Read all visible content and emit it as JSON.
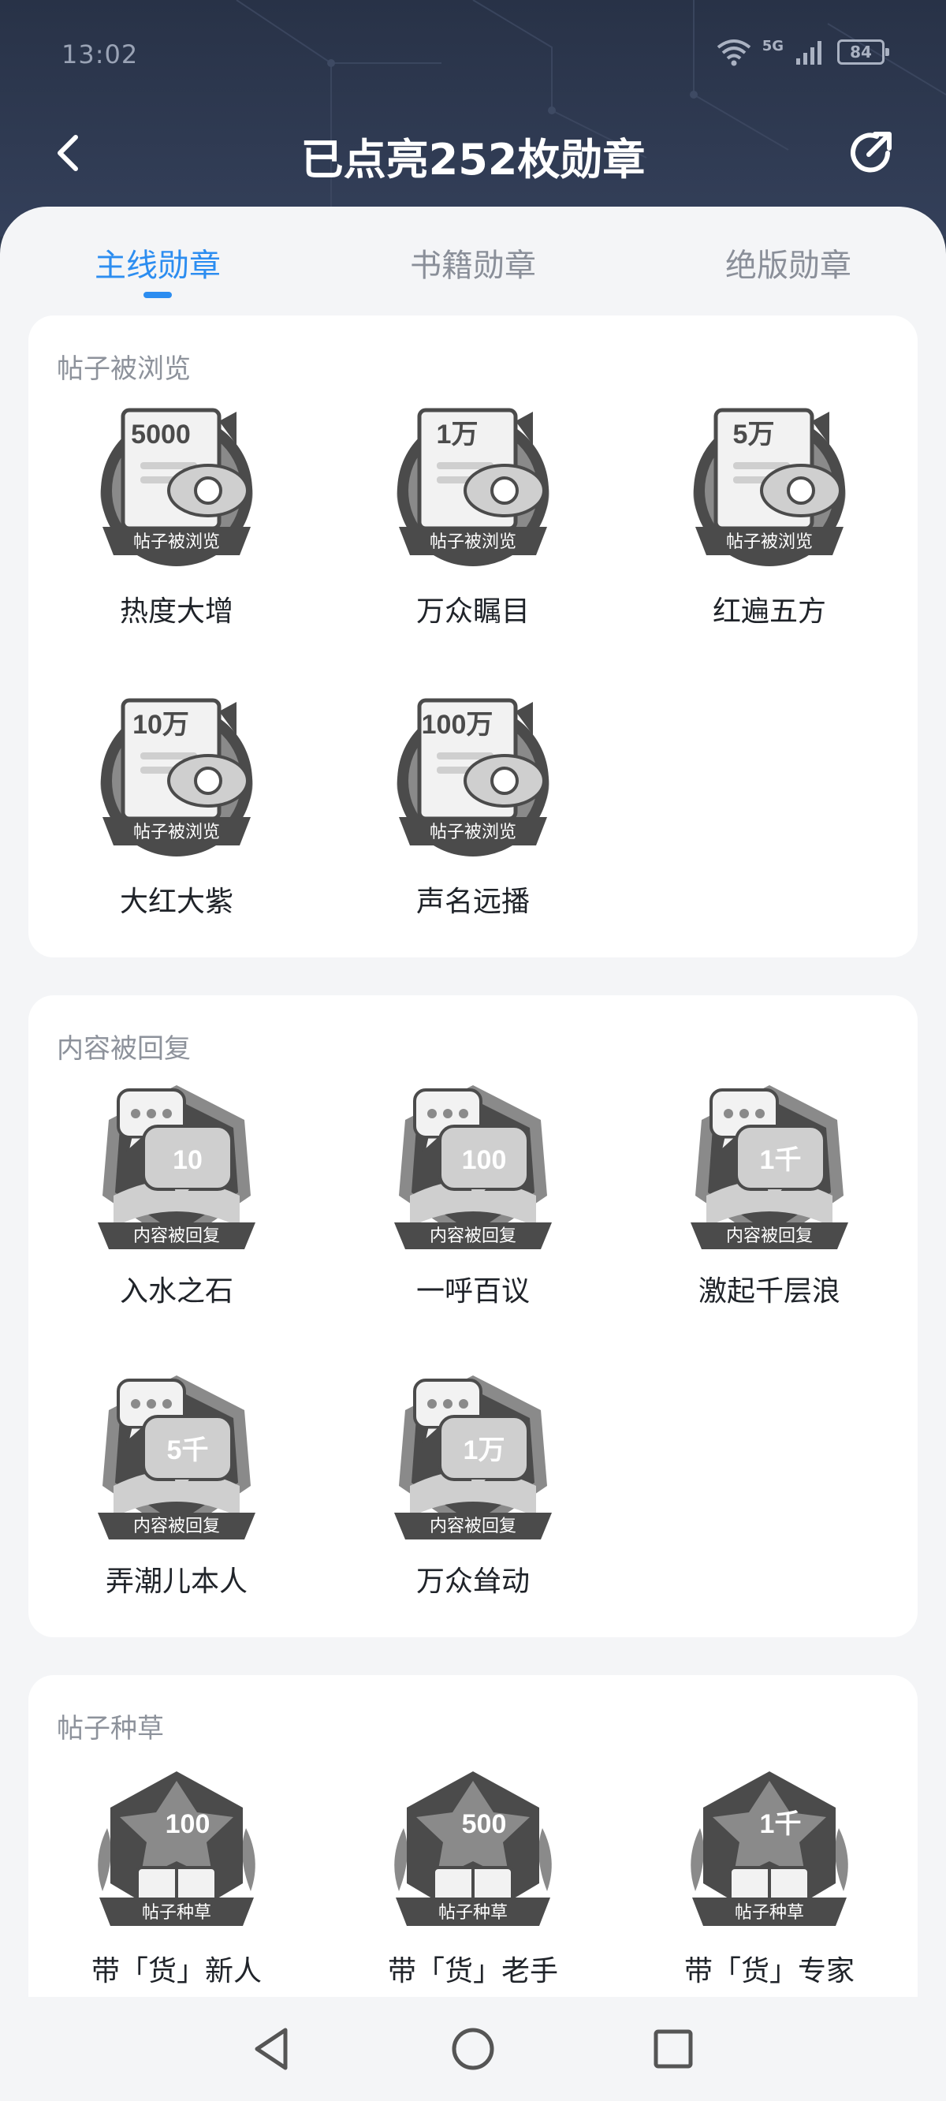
{
  "status": {
    "time": "13:02",
    "network": "5G",
    "battery": "84"
  },
  "nav": {
    "title": "已点亮252枚勋章"
  },
  "tabs": [
    {
      "label": "主线勋章",
      "active": true
    },
    {
      "label": "书籍勋章",
      "active": false
    },
    {
      "label": "绝版勋章",
      "active": false
    }
  ],
  "sections": [
    {
      "title": "帖子被浏览",
      "type": "view",
      "badges": [
        {
          "value": "5000",
          "ribbon": "帖子被浏览",
          "name": "热度大增"
        },
        {
          "value": "1万",
          "ribbon": "帖子被浏览",
          "name": "万众瞩目"
        },
        {
          "value": "5万",
          "ribbon": "帖子被浏览",
          "name": "红遍五方"
        },
        {
          "value": "10万",
          "ribbon": "帖子被浏览",
          "name": "大红大紫"
        },
        {
          "value": "100万",
          "ribbon": "帖子被浏览",
          "name": "声名远播"
        }
      ]
    },
    {
      "title": "内容被回复",
      "type": "reply",
      "badges": [
        {
          "value": "10",
          "ribbon": "内容被回复",
          "name": "入水之石"
        },
        {
          "value": "100",
          "ribbon": "内容被回复",
          "name": "一呼百议"
        },
        {
          "value": "1千",
          "ribbon": "内容被回复",
          "name": "激起千层浪"
        },
        {
          "value": "5千",
          "ribbon": "内容被回复",
          "name": "弄潮儿本人"
        },
        {
          "value": "1万",
          "ribbon": "内容被回复",
          "name": "万众耸动"
        }
      ]
    },
    {
      "title": "帖子种草",
      "type": "seed",
      "badges": [
        {
          "value": "100",
          "ribbon": "帖子种草",
          "name": "带「货」新人"
        },
        {
          "value": "500",
          "ribbon": "帖子种草",
          "name": "带「货」老手"
        },
        {
          "value": "1千",
          "ribbon": "帖子种草",
          "name": "带「货」专家"
        }
      ]
    }
  ],
  "icons": {
    "back": "chevron-left-icon",
    "share": "share-icon",
    "wifi": "wifi-icon",
    "signal": "signal-icon",
    "battery": "battery-icon",
    "sys_back": "triangle-back-icon",
    "sys_home": "circle-home-icon",
    "sys_recent": "square-recent-icon"
  },
  "colors": {
    "accent": "#2c8df0",
    "header": "#2f3a4f",
    "badge_dark": "#4a4a4a",
    "badge_light": "#c9c9c9"
  }
}
